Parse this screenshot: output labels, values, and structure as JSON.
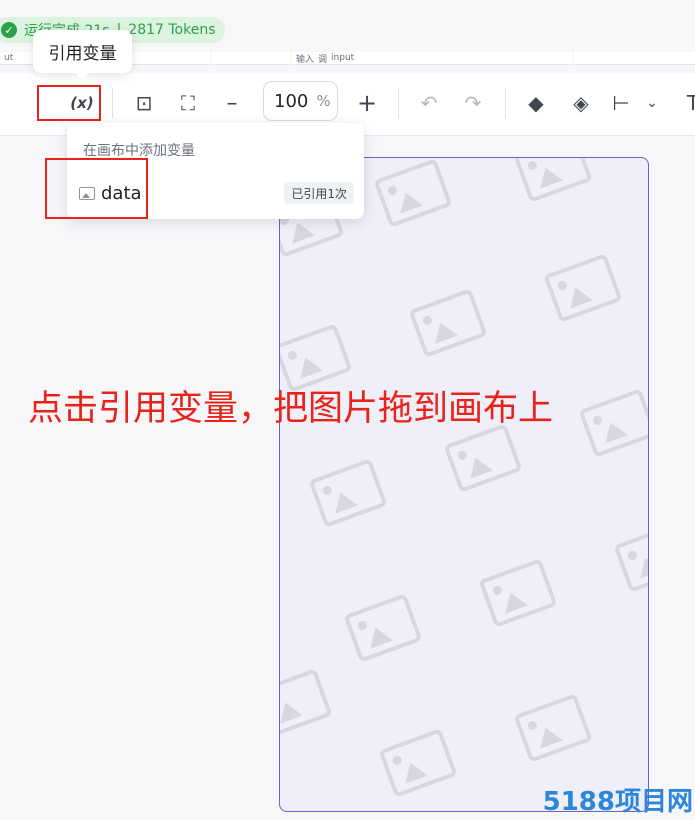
{
  "status": {
    "text": "运行完成 21s",
    "tokens": "2817 Tokens"
  },
  "fragments": {
    "left": "ut",
    "mid_label": "输入",
    "mid_type": "调",
    "mid_value": "input"
  },
  "tooltip": {
    "label": "引用变量"
  },
  "toolbar": {
    "variable_button": "(x)",
    "zoom_value": "100",
    "zoom_unit": "%",
    "zoom_out": "–",
    "zoom_in": "+",
    "add_frame": "⊡",
    "fit_view": "⛶",
    "undo": "↶",
    "redo": "↷",
    "layer_up": "◆",
    "layers": "◈",
    "align": "⊢",
    "align_chevron": "⌄",
    "text_tool": "T"
  },
  "dropdown": {
    "header": "在画布中添加变量",
    "variable_name": "data",
    "reference_badge": "已引用1次"
  },
  "annotation": {
    "text": "点击引用变量，把图片拖到画布上"
  },
  "watermark": {
    "text": "5188项目网"
  }
}
